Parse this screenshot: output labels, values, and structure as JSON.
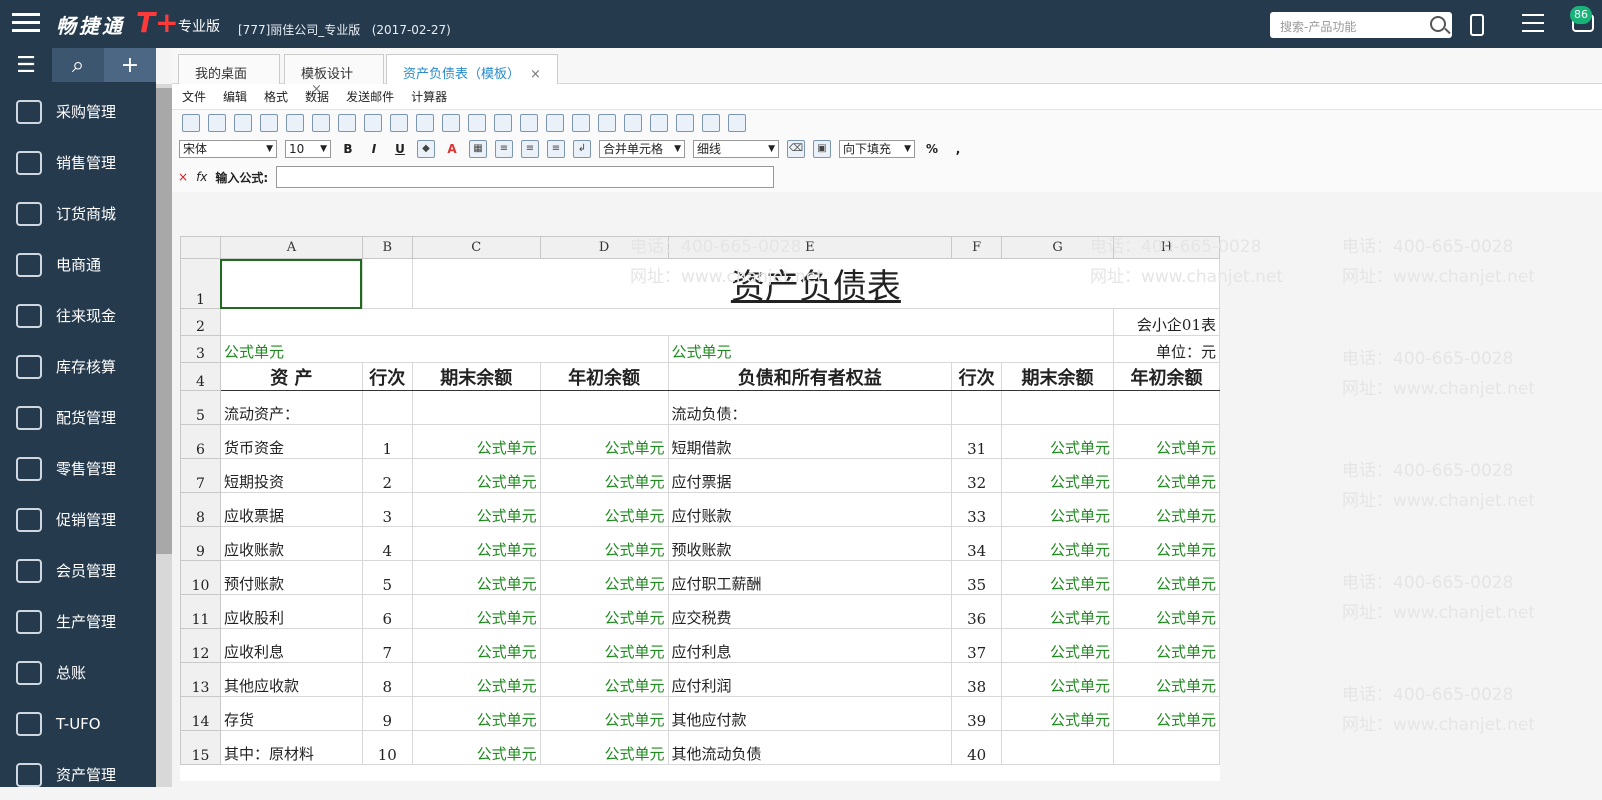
{
  "app": {
    "brand": "畅捷通",
    "brand_mark": "T+",
    "edition": "专业版",
    "company": "[777]丽佳公司_专业版",
    "date": "(2017-02-27)",
    "search_placeholder": "搜索-产品功能",
    "notification_count": "86"
  },
  "sidebar": {
    "items": [
      "采购管理",
      "销售管理",
      "订货商城",
      "电商通",
      "往来现金",
      "库存核算",
      "配货管理",
      "零售管理",
      "促销管理",
      "会员管理",
      "生产管理",
      "总账",
      "T-UFO",
      "资产管理"
    ]
  },
  "tabs": [
    {
      "label": "我的桌面"
    },
    {
      "label": "模板设计"
    },
    {
      "label": "资产负债表（模板）"
    }
  ],
  "menu": [
    "文件",
    "编辑",
    "格式",
    "数据",
    "发送邮件",
    "计算器"
  ],
  "toolbar": {
    "font": "宋体",
    "size": "10",
    "merge": "合并单元格",
    "line": "细线",
    "fill": "向下填充",
    "formula_label": "输入公式:"
  },
  "watermarks": [
    "电话：400-665-0028",
    "网址：www.chanjet.net"
  ],
  "sheet": {
    "columns": [
      "A",
      "B",
      "C",
      "D",
      "E",
      "F",
      "G",
      "H"
    ],
    "title": "资产负债表",
    "form_code": "会小企01表",
    "unit": "单位：元",
    "formula_cell": "公式单元",
    "headers": [
      "资 产",
      "行次",
      "期末余额",
      "年初余额",
      "负债和所有者权益",
      "行次",
      "期末余额",
      "年初余额"
    ],
    "section_left": "流动资产：",
    "section_right": "流动负债：",
    "rows": [
      {
        "num": "6",
        "a": "货币资金",
        "b": "1",
        "e": "短期借款",
        "f": "31"
      },
      {
        "num": "7",
        "a": "短期投资",
        "b": "2",
        "e": "应付票据",
        "f": "32"
      },
      {
        "num": "8",
        "a": "应收票据",
        "b": "3",
        "e": "应付账款",
        "f": "33"
      },
      {
        "num": "9",
        "a": "应收账款",
        "b": "4",
        "e": "预收账款",
        "f": "34"
      },
      {
        "num": "10",
        "a": "预付账款",
        "b": "5",
        "e": "应付职工薪酬",
        "f": "35"
      },
      {
        "num": "11",
        "a": "应收股利",
        "b": "6",
        "e": "应交税费",
        "f": "36"
      },
      {
        "num": "12",
        "a": "应收利息",
        "b": "7",
        "e": "应付利息",
        "f": "37"
      },
      {
        "num": "13",
        "a": "其他应收款",
        "b": "8",
        "e": "应付利润",
        "f": "38"
      },
      {
        "num": "14",
        "a": "存货",
        "b": "9",
        "e": "其他应付款",
        "f": "39"
      },
      {
        "num": "15",
        "a": "其中：原材料",
        "b": "10",
        "e": "其他流动负债",
        "f": "40"
      }
    ]
  }
}
